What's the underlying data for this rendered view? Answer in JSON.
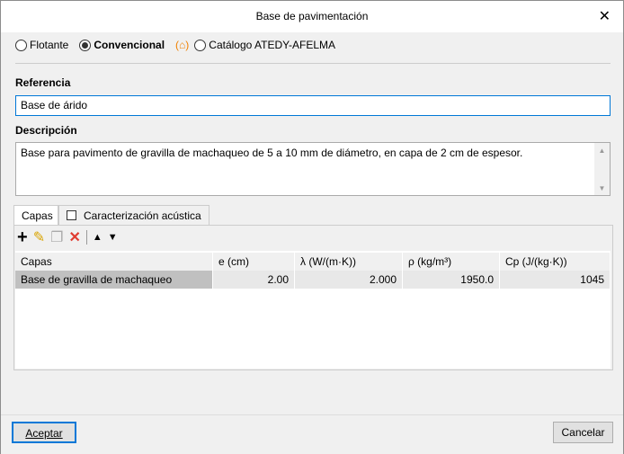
{
  "window": {
    "title": "Base de pavimentación",
    "close": "✕"
  },
  "type_options": [
    {
      "label": "Flotante",
      "selected": false
    },
    {
      "label": "Convencional",
      "selected": true
    },
    {
      "label": "Catálogo ATEDY-AFELMA",
      "selected": false
    }
  ],
  "reference": {
    "label": "Referencia",
    "value": "Base de árido"
  },
  "description": {
    "label": "Descripción",
    "value": "Base para pavimento de gravilla de machaqueo de 5 a 10 mm de diámetro, en capa de 2 cm de espesor."
  },
  "tabs": [
    {
      "label": "Capas"
    },
    {
      "label": "Caracterización acústica",
      "checked": false
    }
  ],
  "table": {
    "columns": [
      "Capas",
      "e (cm)",
      "λ (W/(m·K))",
      "ρ (kg/m³)",
      "Cp (J/(kg·K))"
    ],
    "rows": [
      [
        "Base de gravilla de machaqueo",
        "2.00",
        "2.000",
        "1950.0",
        "1045"
      ]
    ]
  },
  "buttons": {
    "accept": "Aceptar",
    "cancel": "Cancelar"
  },
  "colors": {
    "accent": "#0078d7",
    "delete": "#e03c31",
    "house": "#f08000"
  }
}
